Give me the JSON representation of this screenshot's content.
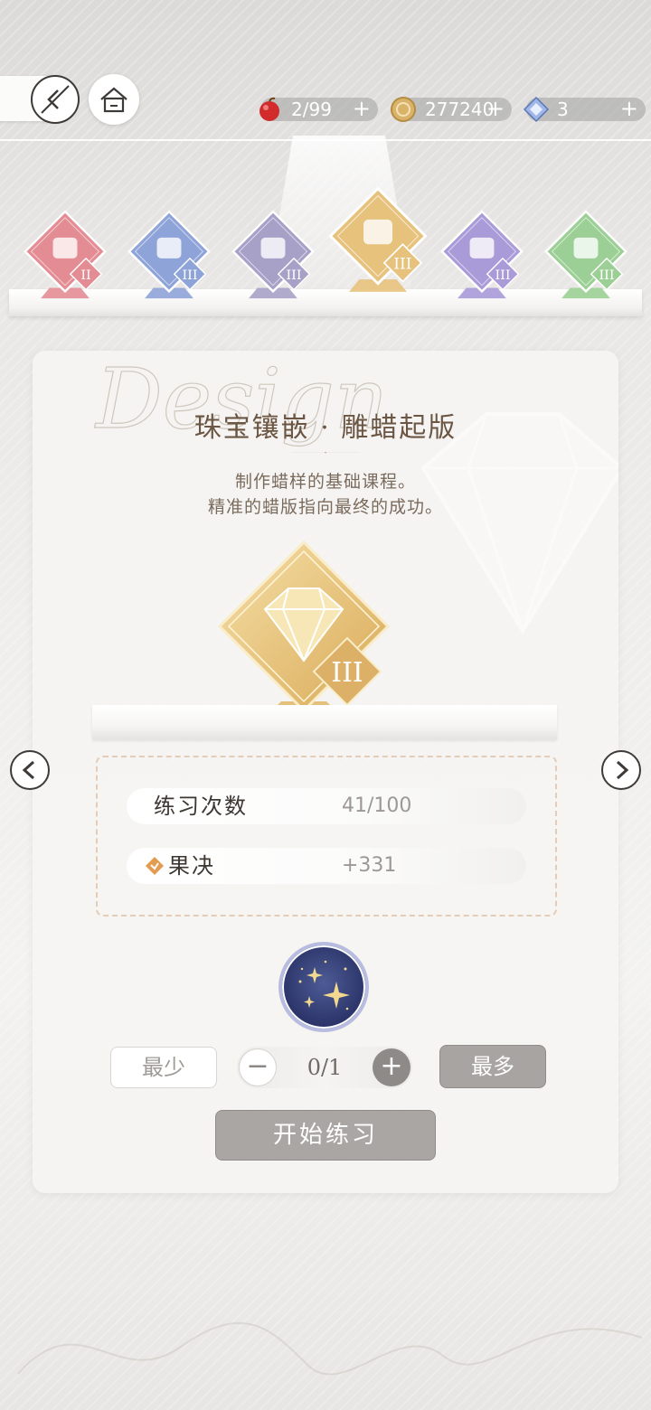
{
  "topbar": {
    "back_icon": "back-arrow-icon",
    "home_icon": "home-icon",
    "resources": [
      {
        "icon": "apple-icon",
        "value": "2/99",
        "plus": "+"
      },
      {
        "icon": "coin-icon",
        "value": "277240",
        "plus": "+"
      },
      {
        "icon": "diamond-icon",
        "value": "3",
        "plus": "+"
      }
    ]
  },
  "categories": [
    {
      "icon": "sweater-icon",
      "level": "II",
      "color": "#e48c93"
    },
    {
      "icon": "high-heel-icon",
      "level": "III",
      "color": "#8ea3d8"
    },
    {
      "icon": "handbag-icon",
      "level": "III",
      "color": "#a7a1c8"
    },
    {
      "icon": "gem-icon",
      "level": "III",
      "color": "#e7c27d",
      "selected": true
    },
    {
      "icon": "makeup-palette-icon",
      "level": "III",
      "color": "#a99ad8"
    },
    {
      "icon": "teddy-bear-icon",
      "level": "III",
      "color": "#9ccf95"
    }
  ],
  "course": {
    "script_word": "Design",
    "title": "珠宝镶嵌 · 雕蜡起版",
    "desc_line1": "制作蜡样的基础课程。",
    "desc_line2": "精准的蜡版指向最终的成功。",
    "badge_level": "III"
  },
  "stats": {
    "practice_label": "练习次数",
    "practice_value": "41/100",
    "attribute_icon": "decisiveness-icon",
    "attribute_label": "果决",
    "attribute_value": "+331"
  },
  "controls": {
    "min_label": "最少",
    "minus": "−",
    "quantity": "0/1",
    "plus": "+",
    "max_label": "最多",
    "start_label": "开始练习"
  },
  "nav": {
    "prev_icon": "chevron-left-icon",
    "next_icon": "chevron-right-icon"
  },
  "colors": {
    "gold": "#e7c27d",
    "text_brown": "#6b5643"
  }
}
